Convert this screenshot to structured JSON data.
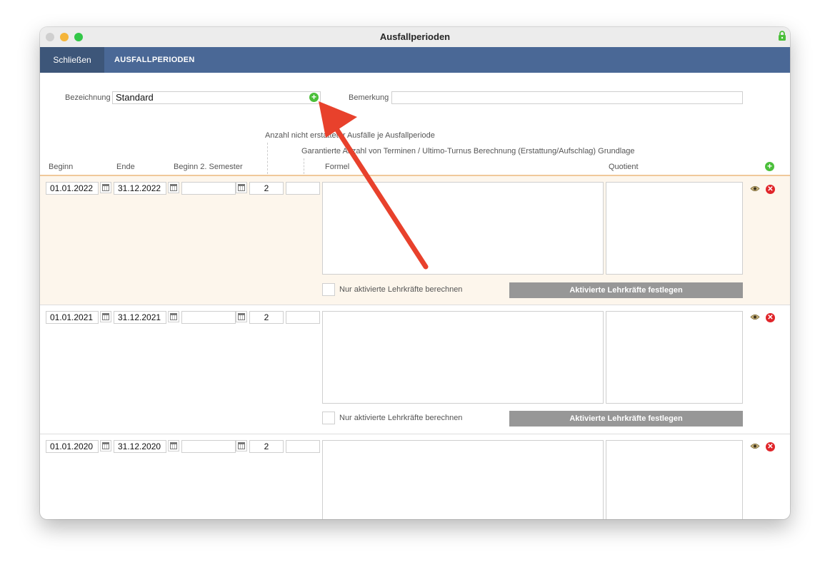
{
  "window": {
    "title": "Ausfallperioden"
  },
  "toolbar": {
    "close_label": "Schließen",
    "section_title": "AUSFALLPERIODEN"
  },
  "header": {
    "bezeichnung_label": "Bezeichnung",
    "bezeichnung_value": "Standard",
    "bemerkung_label": "Bemerkung",
    "bemerkung_value": ""
  },
  "hints": {
    "anzahl": "Anzahl nicht erstatteter Ausfälle je Ausfallperiode",
    "garantierte": "Garantierte Anzahl von Terminen / Ultimo-Turnus Berechnung (Erstattung/Aufschlag) Grundlage"
  },
  "columns": {
    "beginn": "Beginn",
    "ende": "Ende",
    "beginn2": "Beginn 2. Semester",
    "formel": "Formel",
    "quotient": "Quotient"
  },
  "rows": [
    {
      "beginn": "01.01.2022",
      "ende": "31.12.2022",
      "beginn2": "",
      "anzahl": "2",
      "garantiert": "",
      "checkbox_label": "Nur aktivierte Lehrkräfte berechnen",
      "button_label": "Aktivierte Lehrkräfte festlegen"
    },
    {
      "beginn": "01.01.2021",
      "ende": "31.12.2021",
      "beginn2": "",
      "anzahl": "2",
      "garantiert": "",
      "checkbox_label": "Nur aktivierte Lehrkräfte berechnen",
      "button_label": "Aktivierte Lehrkräfte festlegen"
    },
    {
      "beginn": "01.01.2020",
      "ende": "31.12.2020",
      "beginn2": "",
      "anzahl": "2",
      "garantiert": ""
    }
  ],
  "colors": {
    "toolbar": "#4a6896",
    "toolbar_active": "#3d5679",
    "highlight_row": "#fdf6ec",
    "arrow": "#e8412c",
    "add": "#4bbf3a",
    "delete": "#e0252a"
  },
  "icons": {
    "add": "plus-circle-icon",
    "view": "eye-icon",
    "delete": "x-circle-icon",
    "calendar": "calendar-icon",
    "lock": "lock-icon"
  }
}
